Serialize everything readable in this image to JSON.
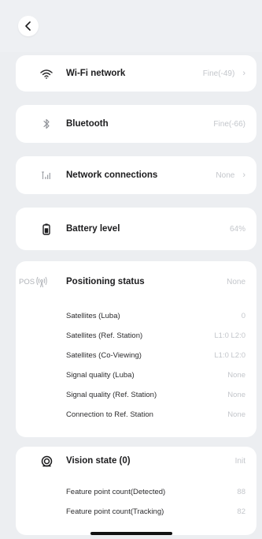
{
  "nav": {
    "back_icon": "chevron-left-icon"
  },
  "wifi": {
    "title": "Wi-Fi network",
    "value": "Fine(-49)",
    "icon": "wifi-icon"
  },
  "bluetooth": {
    "title": "Bluetooth",
    "value": "Fine(-66)",
    "icon": "bluetooth-icon"
  },
  "network": {
    "title": "Network connections",
    "value": "None",
    "icon": "signal-bars-icon"
  },
  "battery": {
    "title": "Battery level",
    "value": "64%",
    "icon": "battery-icon"
  },
  "positioning": {
    "prefix": "POS",
    "title": "Positioning status",
    "value": "None",
    "icon": "pos-signal-icon",
    "rows": [
      {
        "label": "Satellites (Luba)",
        "value": "0"
      },
      {
        "label": "Satellites (Ref. Station)",
        "value": "L1:0 L2:0"
      },
      {
        "label": "Satellites (Co-Viewing)",
        "value": "L1:0 L2:0"
      },
      {
        "label": "Signal quality (Luba)",
        "value": "None"
      },
      {
        "label": "Signal quality (Ref. Station)",
        "value": "None"
      },
      {
        "label": "Connection to Ref. Station",
        "value": "None"
      }
    ]
  },
  "vision": {
    "title": "Vision state (0)",
    "value": "Init",
    "icon": "vision-target-icon",
    "rows": [
      {
        "label": "Feature point count(Detected)",
        "value": "88"
      },
      {
        "label": "Feature point count(Tracking)",
        "value": "82"
      }
    ]
  },
  "colors": {
    "background": "#eceef1",
    "card": "#ffffff",
    "muted": "#c3c6cb"
  }
}
